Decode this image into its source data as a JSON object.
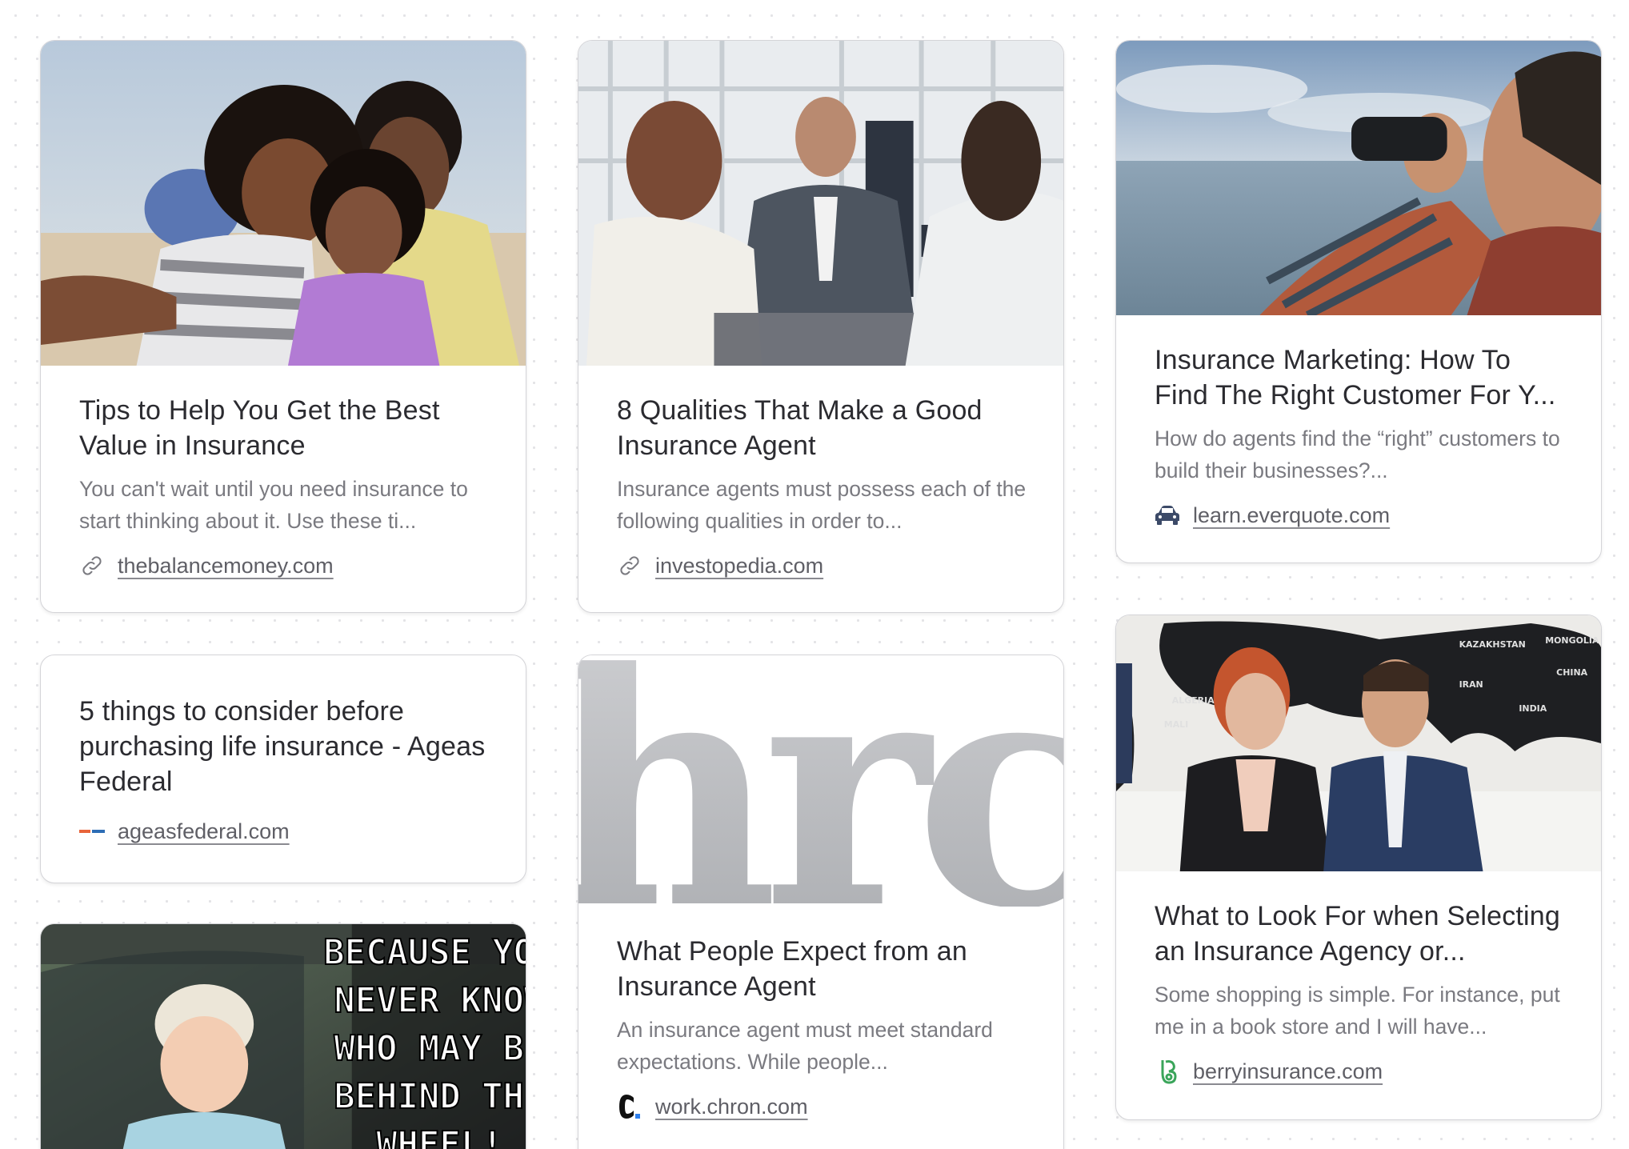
{
  "cards": [
    {
      "title": "Tips to Help You Get the Best Value in Insurance",
      "description": "You can't wait until you need insurance to start thinking about it. Use these ti...",
      "source": "thebalancemoney.com",
      "source_icon": "link-icon"
    },
    {
      "title": "8 Qualities That Make a Good Insurance Agent",
      "description": "Insurance agents must possess each of the following qualities in order to...",
      "source": "investopedia.com",
      "source_icon": "link-icon"
    },
    {
      "title": "Insurance Marketing: How To Find The Right Customer For Y...",
      "description": "How do agents find the “right” customers to build their businesses?...",
      "source": "learn.everquote.com",
      "source_icon": "car-icon"
    },
    {
      "title": "5 things to consider before purchasing life insurance - Ageas Federal",
      "source": "ageasfederal.com",
      "source_icon": "ageas-logo-icon"
    },
    {
      "title": "What People Expect from an Insurance Agent",
      "description": "An insurance agent must meet standard expectations. While people...",
      "source": "work.chron.com",
      "source_icon": "chron-logo-icon",
      "thumb_text": "hrc"
    },
    {
      "title": "What to Look For when Selecting an Insurance Agency or...",
      "description": "Some shopping is simple. For instance, put me in a book store and I will have...",
      "source": "berryinsurance.com",
      "source_icon": "berry-logo-icon"
    },
    {
      "meme_lines": [
        "BECAUSE YOU",
        "NEVER KNOW",
        "WHO MAY BE",
        "BEHIND THE",
        "WHEEL!"
      ]
    }
  ],
  "map_labels": [
    "KAZAKHSTAN",
    "MONGOLIA",
    "CHINA",
    "INDIA",
    "MALI",
    "ALGERIA",
    "IRAN"
  ],
  "colors": {
    "title": "#2b2b30",
    "description": "#7a7a80",
    "link": "#5f5f66",
    "border": "#d4d4d8",
    "berry_green": "#3aa55a",
    "chron_blue": "#2f80ed"
  }
}
